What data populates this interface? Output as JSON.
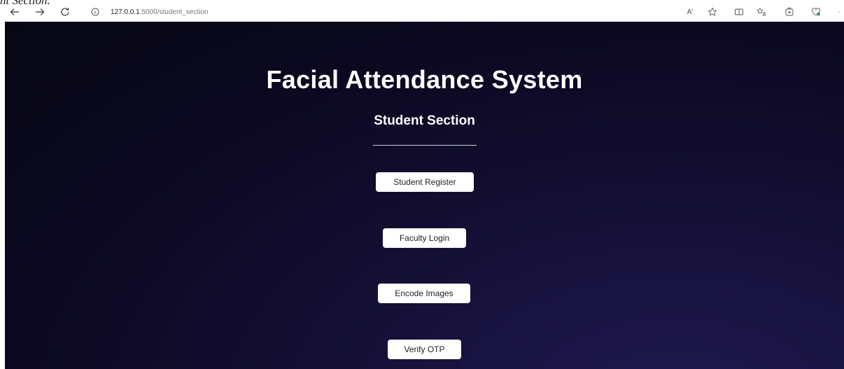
{
  "caption": "nt Section.",
  "browser": {
    "url_host": "127.0.0.1",
    "url_rest": ":5000/student_section",
    "read_aloud_label": "Aʹ"
  },
  "page": {
    "title": "Facial Attendance System",
    "subtitle": "Student Section",
    "buttons": [
      {
        "label": "Student Register"
      },
      {
        "label": "Faculty Login"
      },
      {
        "label": "Encode Images"
      },
      {
        "label": "Verify OTP"
      }
    ]
  }
}
